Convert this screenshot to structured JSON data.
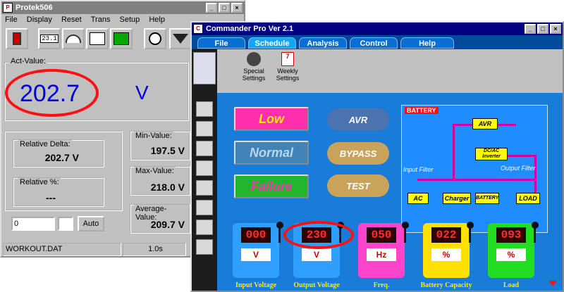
{
  "protek": {
    "title": "Protek506",
    "menu": [
      "File",
      "Display",
      "Reset",
      "Trans",
      "Setup",
      "Help"
    ],
    "act_value_label": "Act-Value:",
    "act_value": "202.7",
    "unit": "V",
    "toolbar_readout": "23.1",
    "relative_delta_label": "Relative Delta:",
    "relative_delta": "202.7 V",
    "relative_pct_label": "Relative %:",
    "relative_pct": "---",
    "min_label": "Min-Value:",
    "min_value": "197.5 V",
    "max_label": "Max-Value:",
    "max_value": "218.0 V",
    "avg_label": "Average-Value:",
    "avg_value": "209.7 V",
    "input_value": "0",
    "auto_label": "Auto",
    "status_file": "WORKOUT.DAT",
    "status_interval": "1.0s"
  },
  "commander": {
    "title": "Commander Pro Ver 2.1",
    "tabs": [
      "File",
      "Schedule",
      "Analysis",
      "Control",
      "Help"
    ],
    "selected_tab": "Schedule",
    "special_settings": "Special Settings",
    "weekly_settings": "Weekly Settings",
    "mode_low": "Low",
    "mode_normal": "Normal",
    "mode_failure": "Failure",
    "btn_avr": "AVR",
    "btn_bypass": "BYPASS",
    "btn_test": "TEST",
    "battery_title": "BATTERY",
    "diagram": {
      "avr": "AVR",
      "dcac": "DC/AC Inverter",
      "input_filter": "Input Filter",
      "output_filter": "Output Filter",
      "ac": "AC",
      "charger": "Charger",
      "battery": "BATTERY",
      "load": "LOAD"
    },
    "meters": [
      {
        "label": "Input Voltage",
        "value": "000",
        "unit": "V",
        "color": "#2fa0ff"
      },
      {
        "label": "Output Voltage",
        "value": "230",
        "unit": "V",
        "color": "#2fa0ff"
      },
      {
        "label": "Freq.",
        "value": "050",
        "unit": "Hz",
        "color": "#ff44cc"
      },
      {
        "label": "Battery Capacity",
        "value": "022",
        "unit": "%",
        "color": "#ffe000"
      },
      {
        "label": "Load",
        "value": "093",
        "unit": "%",
        "color": "#22dd22"
      }
    ],
    "colors": {
      "accent": "#000080",
      "panel": "#1a7cd9",
      "highlight": "#ff0000"
    }
  }
}
